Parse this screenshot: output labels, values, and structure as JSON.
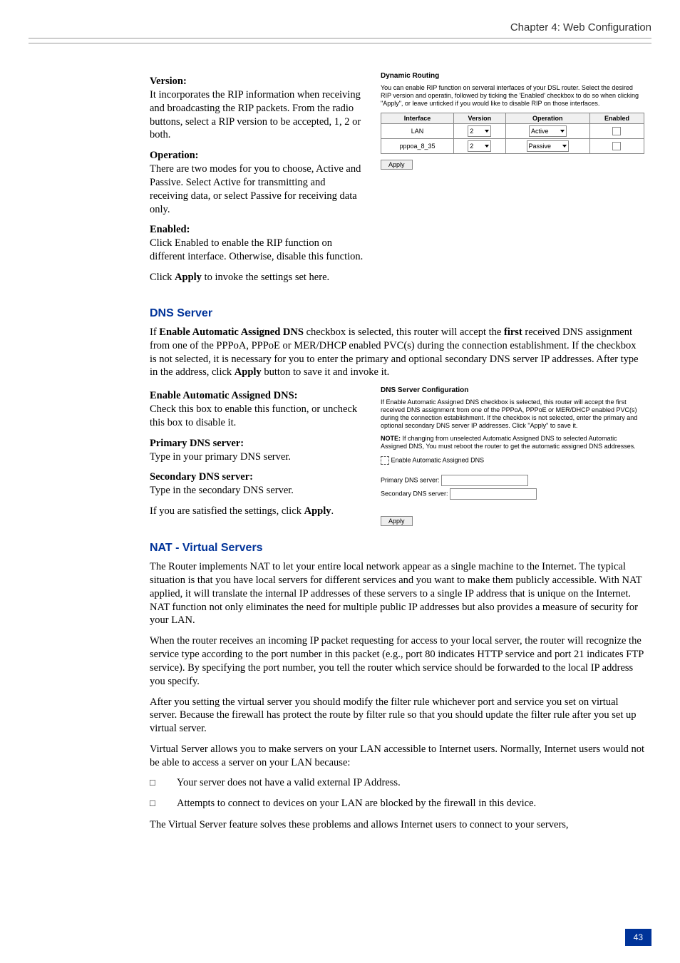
{
  "header": {
    "chapter": "Chapter 4: Web Configuration"
  },
  "rip": {
    "version_label": "Version:",
    "version_text": "It incorporates the RIP information when receiving and broadcasting the RIP packets. From the radio buttons, select a RIP version to be accepted, 1, 2 or both.",
    "operation_label": "Operation:",
    "operation_text": "There are two modes for you to choose, Active and Passive. Select Active for transmitting and receiving data, or select Passive for receiving data only.",
    "enabled_label": "Enabled:",
    "enabled_text": "Click Enabled to enable the RIP function on different interface. Otherwise, disable this function.",
    "apply_pre": "Click ",
    "apply_bold": "Apply",
    "apply_post": " to invoke the settings set here."
  },
  "rip_shot": {
    "title": "Dynamic Routing",
    "desc": "You can enable RIP function on serveral interfaces of your DSL router. Select the desired RIP version and operatin, followed by ticking the 'Enabled' checkbox to do so when clicking \"Apply\", or leave unticked if you would like to disable RIP on those interfaces.",
    "th_interface": "Interface",
    "th_version": "Version",
    "th_operation": "Operation",
    "th_enabled": "Enabled",
    "row1_if": "LAN",
    "row1_ver": "2",
    "row1_op": "Active",
    "row2_if": "pppoa_8_35",
    "row2_ver": "2",
    "row2_op": "Passive",
    "apply": "Apply"
  },
  "dns": {
    "heading": "DNS Server",
    "intro_pre": "If ",
    "intro_b1": "Enable Automatic Assigned DNS",
    "intro_mid1": " checkbox is selected, this router will accept the ",
    "intro_b2": "first",
    "intro_mid2": " received DNS assignment from one of the PPPoA, PPPoE or MER/DHCP enabled PVC(s) during the connection establishment. If the checkbox is not selected, it is necessary for you to enter the primary and optional secondary DNS server IP addresses. After type in the address, click ",
    "intro_b3": "Apply",
    "intro_post": " button to save it and invoke it.",
    "auto_label": "Enable Automatic Assigned DNS:",
    "auto_text": "Check this box to enable this function, or uncheck this box to disable it.",
    "pri_label": "Primary DNS server:",
    "pri_text": "Type in your primary DNS server.",
    "sec_label": "Secondary DNS server:",
    "sec_text": "Type in the secondary DNS server.",
    "sat_pre": "If you are satisfied the settings, click ",
    "sat_b": "Apply",
    "sat_post": "."
  },
  "dns_shot": {
    "title": "DNS Server Configuration",
    "desc": "If Enable Automatic Assigned DNS checkbox is selected, this router will accept the first received DNS assignment from one of the PPPoA, PPPoE or MER/DHCP enabled PVC(s) during the connection establishment. If the checkbox is not selected, enter the primary and optional secondary DNS server IP addresses. Click \"Apply\" to save it.",
    "note_pre": "NOTE: ",
    "note": "If changing from unselected Automatic Assigned DNS to selected Automatic Assigned DNS, You must reboot the router to get the automatic assigned DNS addresses.",
    "cb_label": "Enable Automatic Assigned DNS",
    "pri": "Primary DNS server:",
    "sec": "Secondary DNS server:",
    "apply": "Apply"
  },
  "nat": {
    "heading": "NAT - Virtual Servers",
    "p1": "The Router implements NAT to let your entire local network appear as a single machine to the Internet. The typical situation is that you have local servers for different services and you want to make them publicly accessible. With NAT applied, it will translate the internal IP addresses of these servers to a single IP address that is unique on the Internet. NAT function not only eliminates the need for multiple public IP addresses but also provides a measure of security for your LAN.",
    "p2": "When the router receives an incoming IP packet requesting for access to your local server, the router will recognize the service type according to the port number in this packet (e.g., port 80 indicates HTTP service and port 21 indicates FTP service). By specifying the port number, you tell the router which service should be forwarded to the local IP address you specify.",
    "p3": "After you setting the virtual server you should modify the filter rule whichever port and service you set on virtual server. Because the firewall has protect the route by filter rule so that you should update the filter rule after you set up virtual server.",
    "p4": "Virtual Server allows you to make servers on your LAN accessible to Internet users. Normally, Internet users would not be able to access a server on your LAN because:",
    "li1": "Your server does not have a valid external IP Address.",
    "li2": "Attempts to connect to devices on your LAN are blocked by the firewall in this device.",
    "p5": "The Virtual Server feature solves these problems and allows Internet users to connect to your servers,"
  },
  "pagenum": "43"
}
